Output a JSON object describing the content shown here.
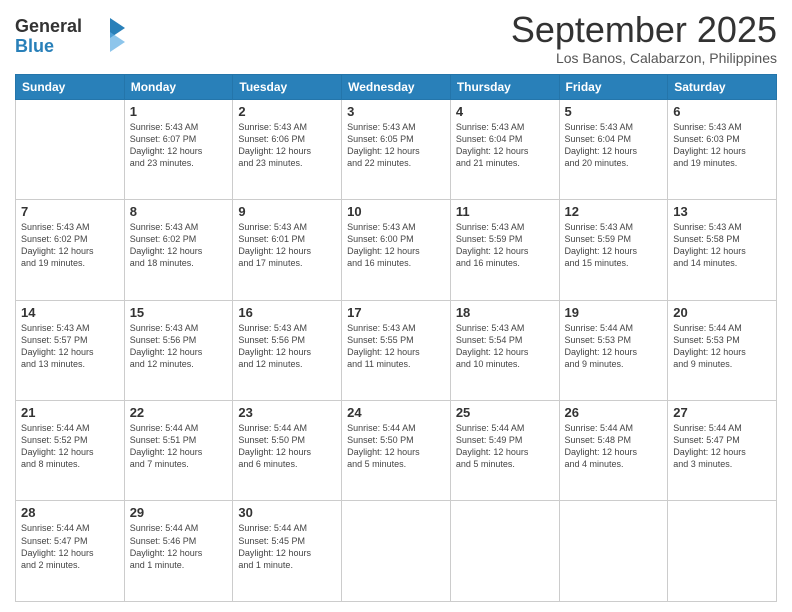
{
  "logo": {
    "general": "General",
    "blue": "Blue"
  },
  "title": "September 2025",
  "location": "Los Banos, Calabarzon, Philippines",
  "weekdays": [
    "Sunday",
    "Monday",
    "Tuesday",
    "Wednesday",
    "Thursday",
    "Friday",
    "Saturday"
  ],
  "weeks": [
    [
      {
        "day": "",
        "info": ""
      },
      {
        "day": "1",
        "info": "Sunrise: 5:43 AM\nSunset: 6:07 PM\nDaylight: 12 hours\nand 23 minutes."
      },
      {
        "day": "2",
        "info": "Sunrise: 5:43 AM\nSunset: 6:06 PM\nDaylight: 12 hours\nand 23 minutes."
      },
      {
        "day": "3",
        "info": "Sunrise: 5:43 AM\nSunset: 6:05 PM\nDaylight: 12 hours\nand 22 minutes."
      },
      {
        "day": "4",
        "info": "Sunrise: 5:43 AM\nSunset: 6:04 PM\nDaylight: 12 hours\nand 21 minutes."
      },
      {
        "day": "5",
        "info": "Sunrise: 5:43 AM\nSunset: 6:04 PM\nDaylight: 12 hours\nand 20 minutes."
      },
      {
        "day": "6",
        "info": "Sunrise: 5:43 AM\nSunset: 6:03 PM\nDaylight: 12 hours\nand 19 minutes."
      }
    ],
    [
      {
        "day": "7",
        "info": "Sunrise: 5:43 AM\nSunset: 6:02 PM\nDaylight: 12 hours\nand 19 minutes."
      },
      {
        "day": "8",
        "info": "Sunrise: 5:43 AM\nSunset: 6:02 PM\nDaylight: 12 hours\nand 18 minutes."
      },
      {
        "day": "9",
        "info": "Sunrise: 5:43 AM\nSunset: 6:01 PM\nDaylight: 12 hours\nand 17 minutes."
      },
      {
        "day": "10",
        "info": "Sunrise: 5:43 AM\nSunset: 6:00 PM\nDaylight: 12 hours\nand 16 minutes."
      },
      {
        "day": "11",
        "info": "Sunrise: 5:43 AM\nSunset: 5:59 PM\nDaylight: 12 hours\nand 16 minutes."
      },
      {
        "day": "12",
        "info": "Sunrise: 5:43 AM\nSunset: 5:59 PM\nDaylight: 12 hours\nand 15 minutes."
      },
      {
        "day": "13",
        "info": "Sunrise: 5:43 AM\nSunset: 5:58 PM\nDaylight: 12 hours\nand 14 minutes."
      }
    ],
    [
      {
        "day": "14",
        "info": "Sunrise: 5:43 AM\nSunset: 5:57 PM\nDaylight: 12 hours\nand 13 minutes."
      },
      {
        "day": "15",
        "info": "Sunrise: 5:43 AM\nSunset: 5:56 PM\nDaylight: 12 hours\nand 12 minutes."
      },
      {
        "day": "16",
        "info": "Sunrise: 5:43 AM\nSunset: 5:56 PM\nDaylight: 12 hours\nand 12 minutes."
      },
      {
        "day": "17",
        "info": "Sunrise: 5:43 AM\nSunset: 5:55 PM\nDaylight: 12 hours\nand 11 minutes."
      },
      {
        "day": "18",
        "info": "Sunrise: 5:43 AM\nSunset: 5:54 PM\nDaylight: 12 hours\nand 10 minutes."
      },
      {
        "day": "19",
        "info": "Sunrise: 5:44 AM\nSunset: 5:53 PM\nDaylight: 12 hours\nand 9 minutes."
      },
      {
        "day": "20",
        "info": "Sunrise: 5:44 AM\nSunset: 5:53 PM\nDaylight: 12 hours\nand 9 minutes."
      }
    ],
    [
      {
        "day": "21",
        "info": "Sunrise: 5:44 AM\nSunset: 5:52 PM\nDaylight: 12 hours\nand 8 minutes."
      },
      {
        "day": "22",
        "info": "Sunrise: 5:44 AM\nSunset: 5:51 PM\nDaylight: 12 hours\nand 7 minutes."
      },
      {
        "day": "23",
        "info": "Sunrise: 5:44 AM\nSunset: 5:50 PM\nDaylight: 12 hours\nand 6 minutes."
      },
      {
        "day": "24",
        "info": "Sunrise: 5:44 AM\nSunset: 5:50 PM\nDaylight: 12 hours\nand 5 minutes."
      },
      {
        "day": "25",
        "info": "Sunrise: 5:44 AM\nSunset: 5:49 PM\nDaylight: 12 hours\nand 5 minutes."
      },
      {
        "day": "26",
        "info": "Sunrise: 5:44 AM\nSunset: 5:48 PM\nDaylight: 12 hours\nand 4 minutes."
      },
      {
        "day": "27",
        "info": "Sunrise: 5:44 AM\nSunset: 5:47 PM\nDaylight: 12 hours\nand 3 minutes."
      }
    ],
    [
      {
        "day": "28",
        "info": "Sunrise: 5:44 AM\nSunset: 5:47 PM\nDaylight: 12 hours\nand 2 minutes."
      },
      {
        "day": "29",
        "info": "Sunrise: 5:44 AM\nSunset: 5:46 PM\nDaylight: 12 hours\nand 1 minute."
      },
      {
        "day": "30",
        "info": "Sunrise: 5:44 AM\nSunset: 5:45 PM\nDaylight: 12 hours\nand 1 minute."
      },
      {
        "day": "",
        "info": ""
      },
      {
        "day": "",
        "info": ""
      },
      {
        "day": "",
        "info": ""
      },
      {
        "day": "",
        "info": ""
      }
    ]
  ]
}
